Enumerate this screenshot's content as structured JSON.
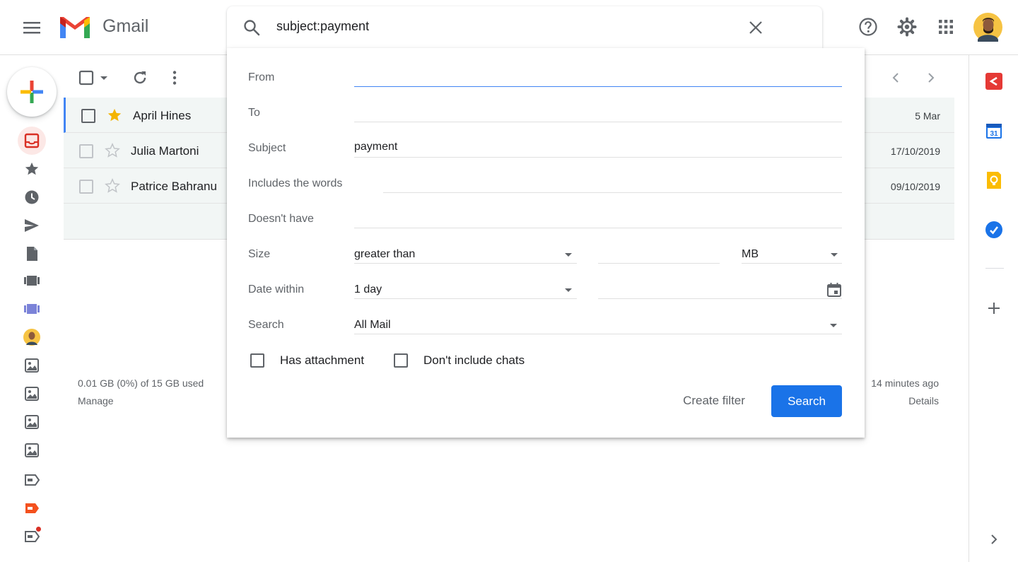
{
  "app": {
    "title": "Gmail"
  },
  "search": {
    "query": "subject:payment"
  },
  "advanced_search": {
    "from_label": "From",
    "from_value": "",
    "to_label": "To",
    "to_value": "",
    "subject_label": "Subject",
    "subject_value": "payment",
    "includes_label": "Includes the words",
    "includes_value": "",
    "doesnt_have_label": "Doesn't have",
    "doesnt_have_value": "",
    "size_label": "Size",
    "size_operator": "greater than",
    "size_value": "",
    "size_unit": "MB",
    "date_label": "Date within",
    "date_value": "1 day",
    "date_field": "",
    "search_label": "Search",
    "search_scope": "All Mail",
    "has_attachment_label": "Has attachment",
    "dont_include_chats_label": "Don't include chats",
    "create_filter_label": "Create filter",
    "search_button_label": "Search"
  },
  "mail_list": [
    {
      "sender": "April Hines",
      "date": "5 Mar",
      "starred": true
    },
    {
      "sender": "Julia Martoni",
      "date": "17/10/2019",
      "starred": false
    },
    {
      "sender": "Patrice Bahranu",
      "date": "09/10/2019",
      "starred": false
    }
  ],
  "footer": {
    "storage": "0.01 GB (0%) of 15 GB used",
    "manage": "Manage",
    "activity": "14 minutes ago",
    "details": "Details"
  },
  "right_rail": {
    "calendar_day": "31"
  },
  "colors": {
    "primary": "#1a73e8",
    "gmail_red": "#ea4335",
    "star_yellow": "#f4b400",
    "focus_blue": "#4285f4"
  },
  "icons": [
    "menu-icon",
    "search-icon",
    "close-icon",
    "help-icon",
    "gear-icon",
    "apps-grid-icon",
    "avatar",
    "compose-plus-icon",
    "inbox-icon",
    "star-icon",
    "clock-icon",
    "send-icon",
    "draft-icon",
    "category-icon",
    "label-icon",
    "calendar-icon",
    "keep-icon",
    "tasks-icon",
    "plus-icon",
    "chevron-right-icon",
    "chevron-left-icon"
  ]
}
